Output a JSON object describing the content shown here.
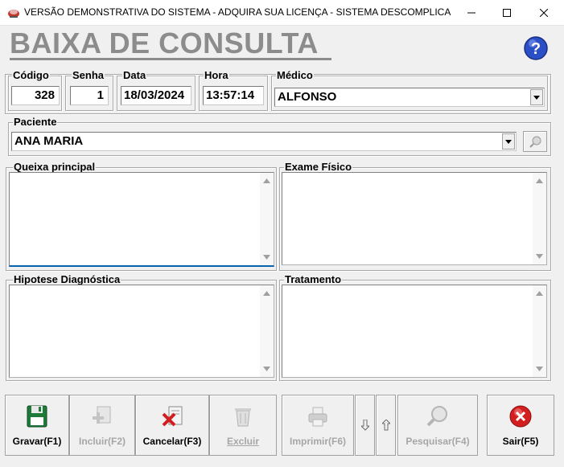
{
  "window": {
    "title": "VERSÃO DEMONSTRATIVA DO SISTEMA - ADQUIRA SUA LICENÇA - SISTEMA DESCOMPLICADO -..."
  },
  "page": {
    "title": "BAIXA DE CONSULTA"
  },
  "header_fields": {
    "codigo": {
      "label": "Código",
      "value": "328"
    },
    "senha": {
      "label": "Senha",
      "value": "1"
    },
    "data": {
      "label": "Data",
      "value": "18/03/2024"
    },
    "hora": {
      "label": "Hora",
      "value": "13:57:14"
    },
    "medico": {
      "label": "Médico",
      "value": "ALFONSO"
    }
  },
  "paciente": {
    "label": "Paciente",
    "value": "ANA MARIA"
  },
  "memos": {
    "queixa": {
      "label": "Queixa principal",
      "value": ""
    },
    "exame": {
      "label": "Exame Físico",
      "value": ""
    },
    "hipotese": {
      "label": "Hipotese Diagnóstica",
      "value": ""
    },
    "tratamento": {
      "label": "Tratamento",
      "value": ""
    }
  },
  "toolbar": {
    "gravar": "Gravar(F1)",
    "incluir": "Incluir(F2)",
    "cancelar": "Cancelar(F3)",
    "excluir": "Excluir",
    "imprimir": "Imprimir(F6)",
    "pesquisar": "Pesquisar(F4)",
    "sair": "Sair(F5)"
  },
  "colors": {
    "title_gray": "#8c8c8c",
    "focus_blue": "#0a64ad",
    "help_blue": "#2b4fc7",
    "exit_red": "#d21e1e"
  }
}
